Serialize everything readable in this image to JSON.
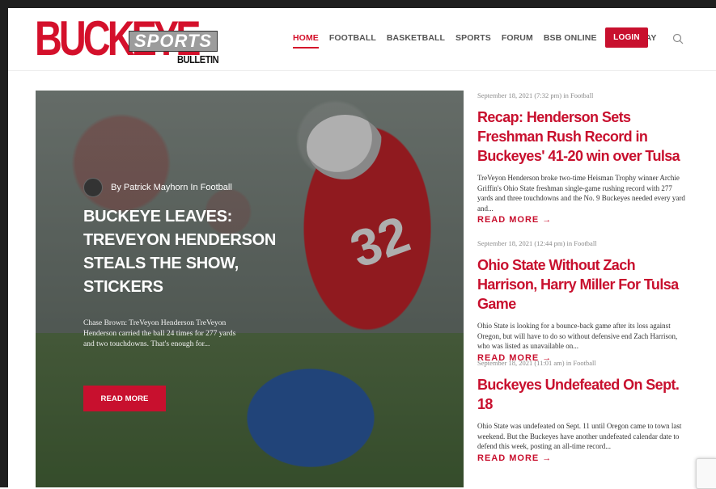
{
  "logo": {
    "main": "BUCKEYE",
    "sports": "SPORTS",
    "bulletin": "BULLETIN"
  },
  "nav": {
    "items": [
      {
        "label": "HOME",
        "active": true
      },
      {
        "label": "FOOTBALL",
        "active": false
      },
      {
        "label": "BASKETBALL",
        "active": false
      },
      {
        "label": "SPORTS",
        "active": false
      },
      {
        "label": "FORUM",
        "active": false
      },
      {
        "label": "BSB ONLINE",
        "active": false
      },
      {
        "label": "EAT & STAY",
        "active": false
      }
    ],
    "login": "LOGIN",
    "search_icon": "search-icon"
  },
  "hero": {
    "author": "By Patrick Mayhorn In Football",
    "title": "BUCKEYE LEAVES: TREVEYON HENDERSON STEALS THE SHOW, STICKERS",
    "excerpt": "Chase Brown: TreVeyon Henderson TreVeyon Henderson carried the ball 24 times for 277 yards and two touchdowns. That's enough for...",
    "read_more": "READ MORE",
    "jersey_number": "32"
  },
  "posts": [
    {
      "meta": "September 18, 2021 (7:32 pm) in Football",
      "title": "Recap: Henderson Sets Freshman Rush Record in Buckeyes' 41-20 win over Tulsa",
      "excerpt": "TreVeyon Henderson broke two-time Heisman Trophy winner Archie Griffin's Ohio State freshman single-game rushing record with 277 yards and three touchdowns and the No. 9 Buckeyes needed every yard and...",
      "read_more": "READ MORE →"
    },
    {
      "meta": "September 18, 2021 (12:44 pm) in Football",
      "title": "Ohio State Without Zach Harrison, Harry Miller For Tulsa Game",
      "excerpt": "Ohio State is looking for a bounce-back game after its loss against Oregon, but will have to do so without defensive end Zach Harrison, who was listed as unavailable on...",
      "read_more": "READ MORE →"
    },
    {
      "meta": "September 18, 2021 (11:01 am) in Football",
      "title": "Buckeyes Undefeated On Sept. 18",
      "excerpt": "Ohio State was undefeated on Sept. 11 until Oregon came to town last weekend. But the Buckeyes have another undefeated calendar date to defend this week, posting an all-time record...",
      "read_more": "READ MORE →"
    }
  ],
  "colors": {
    "brand_red": "#c8102e",
    "text_dark": "#333333",
    "meta_gray": "#8a8a8a"
  }
}
